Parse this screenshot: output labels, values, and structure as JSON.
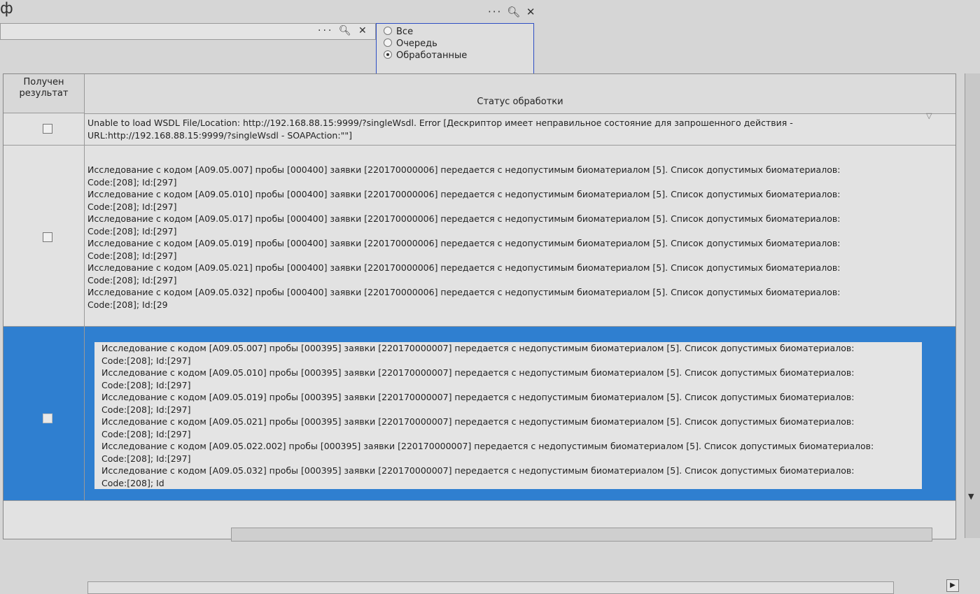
{
  "top": {
    "leading_text": "ф"
  },
  "filters": {
    "input_value": "",
    "radio_options": [
      {
        "label": "Все",
        "selected": false
      },
      {
        "label": "Очередь",
        "selected": false
      },
      {
        "label": "Обработанные",
        "selected": true
      }
    ]
  },
  "table": {
    "columns": [
      {
        "label": "Получен результат"
      },
      {
        "label": "Статус обработки"
      }
    ],
    "rows": [
      {
        "checked": false,
        "lines": [
          "Unable to load WSDL File/Location: http://192.168.88.15:9999/?singleWsdl.  Error [Дескриптор имеет неправильное состояние для запрошенного действия -",
          "URL:http://192.168.88.15:9999/?singleWsdl - SOAPAction:\"\"]"
        ]
      },
      {
        "checked": false,
        "lines": [
          "Исследование с кодом [A09.05.007] пробы [000400] заявки [220170000006] передается с недопустимым биоматериалом [5]. Список допустимых биоматериалов:",
          "Code:[208]; Id:[297]",
          "Исследование с кодом [A09.05.010] пробы [000400] заявки [220170000006] передается с недопустимым биоматериалом [5]. Список допустимых биоматериалов:",
          "Code:[208]; Id:[297]",
          "Исследование с кодом [A09.05.017] пробы [000400] заявки [220170000006] передается с недопустимым биоматериалом [5]. Список допустимых биоматериалов:",
          "Code:[208]; Id:[297]",
          "Исследование с кодом [A09.05.019] пробы [000400] заявки [220170000006] передается с недопустимым биоматериалом [5]. Список допустимых биоматериалов:",
          "Code:[208]; Id:[297]",
          "Исследование с кодом [A09.05.021] пробы [000400] заявки [220170000006] передается с недопустимым биоматериалом [5]. Список допустимых биоматериалов:",
          "Code:[208]; Id:[297]",
          "Исследование с кодом [A09.05.032] пробы [000400] заявки [220170000006] передается с недопустимым биоматериалом [5]. Список допустимых биоматериалов:",
          "Code:[208]; Id:[29"
        ]
      },
      {
        "checked": false,
        "selected": true,
        "lines": [
          "Исследование с кодом [A09.05.007] пробы [000395] заявки [220170000007] передается с недопустимым биоматериалом [5]. Список допустимых биоматериалов:",
          "Code:[208]; Id:[297]",
          "Исследование с кодом [A09.05.010] пробы [000395] заявки [220170000007] передается с недопустимым биоматериалом [5]. Список допустимых биоматериалов:",
          "Code:[208]; Id:[297]",
          "Исследование с кодом [A09.05.019] пробы [000395] заявки [220170000007] передается с недопустимым биоматериалом [5]. Список допустимых биоматериалов:",
          "Code:[208]; Id:[297]",
          "Исследование с кодом [A09.05.021] пробы [000395] заявки [220170000007] передается с недопустимым биоматериалом [5]. Список допустимых биоматериалов:",
          "Code:[208]; Id:[297]",
          "Исследование с кодом [A09.05.022.002] пробы [000395] заявки [220170000007] передается с недопустимым биоматериалом [5]. Список допустимых биоматериалов:",
          "Code:[208]; Id:[297]",
          "Исследование с кодом [A09.05.032] пробы [000395] заявки [220170000007] передается с недопустимым биоматериалом [5]. Список допустимых биоматериалов:",
          "Code:[208]; Id"
        ]
      }
    ]
  },
  "colors": {
    "selection": "#2f7fd0",
    "radio_border": "#2f4fc4"
  },
  "icons": [
    "ellipsis-icon",
    "search-icon",
    "close-icon",
    "filter-arrow-icon",
    "scroll-down-icon",
    "scroll-right-icon"
  ]
}
